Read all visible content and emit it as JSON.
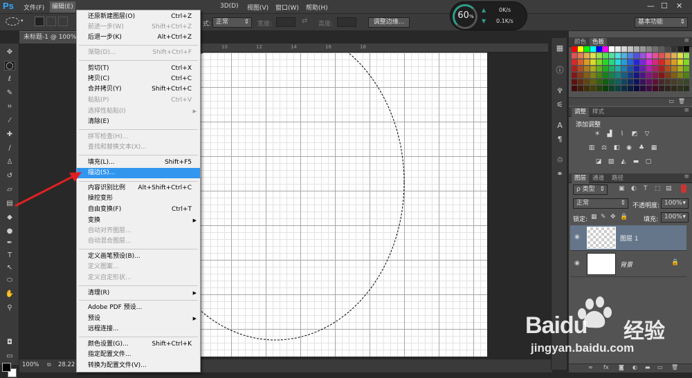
{
  "app": {
    "logo": "Ps"
  },
  "menubar": {
    "items": [
      "文件(F)",
      "编辑(E)"
    ],
    "right_items": [
      "3D(D)",
      "视图(V)",
      "窗口(W)",
      "帮助(H)"
    ],
    "window_controls": [
      "—",
      "☐",
      "✕"
    ]
  },
  "options_bar": {
    "style_label": "式:",
    "style_value": "正常",
    "width_label": "宽度:",
    "height_label": "高度:",
    "swap_icon": "swap-arrows-icon",
    "refine_edge_button": "调整边缘...",
    "workspace_value": "基本功能"
  },
  "perf_widget": {
    "percent": "60",
    "percent_unit": "%",
    "upload": "0K/s",
    "download": "0.1K/s"
  },
  "document": {
    "tab_title": "未标题-1 @ 100%",
    "zoom": "100%",
    "doc_info": "28.22"
  },
  "ruler_top": {
    "labels": [
      "10",
      "12",
      "14",
      "16",
      "18"
    ]
  },
  "edit_menu": {
    "items": [
      {
        "label": "还原新建图层(O)",
        "shortcut": "Ctrl+Z",
        "disabled": false
      },
      {
        "label": "前进一步(W)",
        "shortcut": "Shift+Ctrl+Z",
        "disabled": true
      },
      {
        "label": "后退一步(K)",
        "shortcut": "Alt+Ctrl+Z",
        "disabled": false
      },
      {
        "label": "渐隐(D)...",
        "shortcut": "Shift+Ctrl+F",
        "disabled": true
      },
      {
        "label": "剪切(T)",
        "shortcut": "Ctrl+X",
        "disabled": false
      },
      {
        "label": "拷贝(C)",
        "shortcut": "Ctrl+C",
        "disabled": false
      },
      {
        "label": "合并拷贝(Y)",
        "shortcut": "Shift+Ctrl+C",
        "disabled": false
      },
      {
        "label": "粘贴(P)",
        "shortcut": "Ctrl+V",
        "disabled": true
      },
      {
        "label": "选择性粘贴(I)",
        "shortcut": "",
        "disabled": true,
        "submenu": true
      },
      {
        "label": "清除(E)",
        "shortcut": "",
        "disabled": false
      },
      {
        "label": "拼写检查(H)...",
        "shortcut": "",
        "disabled": true
      },
      {
        "label": "查找和替换文本(X)...",
        "shortcut": "",
        "disabled": true
      },
      {
        "label": "填充(L)...",
        "shortcut": "Shift+F5",
        "disabled": false
      },
      {
        "label": "描边(S)...",
        "shortcut": "",
        "disabled": false,
        "highlighted": true
      },
      {
        "label": "内容识别比例",
        "shortcut": "Alt+Shift+Ctrl+C",
        "disabled": false
      },
      {
        "label": "操控变形",
        "shortcut": "",
        "disabled": false
      },
      {
        "label": "自由变换(F)",
        "shortcut": "Ctrl+T",
        "disabled": false
      },
      {
        "label": "变换",
        "shortcut": "",
        "disabled": false,
        "submenu": true
      },
      {
        "label": "自动对齐图层...",
        "shortcut": "",
        "disabled": true
      },
      {
        "label": "自动混合图层...",
        "shortcut": "",
        "disabled": true
      },
      {
        "label": "定义画笔预设(B)...",
        "shortcut": "",
        "disabled": false
      },
      {
        "label": "定义图案...",
        "shortcut": "",
        "disabled": true
      },
      {
        "label": "定义自定形状...",
        "shortcut": "",
        "disabled": true
      },
      {
        "label": "清理(R)",
        "shortcut": "",
        "disabled": false,
        "submenu": true
      },
      {
        "label": "Adobe PDF 预设...",
        "shortcut": "",
        "disabled": false
      },
      {
        "label": "预设",
        "shortcut": "",
        "disabled": false,
        "submenu": true
      },
      {
        "label": "远程连接...",
        "shortcut": "",
        "disabled": false
      },
      {
        "label": "颜色设置(G)...",
        "shortcut": "Shift+Ctrl+K",
        "disabled": false
      },
      {
        "label": "指定配置文件...",
        "shortcut": "",
        "disabled": false
      },
      {
        "label": "转换为配置文件(V)...",
        "shortcut": "",
        "disabled": false
      }
    ]
  },
  "panels": {
    "color": {
      "tabs": [
        "颜色",
        "色板"
      ]
    },
    "adjustments": {
      "tabs": [
        "调整",
        "样式"
      ],
      "title": "添加调整"
    },
    "layers": {
      "tabs": [
        "图层",
        "通道",
        "路径"
      ],
      "filter_label": "ρ 类型",
      "blend_mode": "正常",
      "opacity_label": "不透明度:",
      "opacity_value": "100%",
      "lock_label": "锁定:",
      "fill_label": "填充:",
      "fill_value": "100%",
      "layers": [
        {
          "name": "图层 1",
          "selected": true
        },
        {
          "name": "背景",
          "selected": false,
          "locked": true
        }
      ],
      "footer_icons": [
        "link-icon",
        "fx-icon",
        "mask-icon",
        "adjustment-icon",
        "group-icon",
        "new-layer-icon",
        "trash-icon"
      ]
    }
  },
  "watermark": {
    "brand": "Baidu",
    "cn": "经验",
    "url": "jingyan.baidu.com"
  }
}
